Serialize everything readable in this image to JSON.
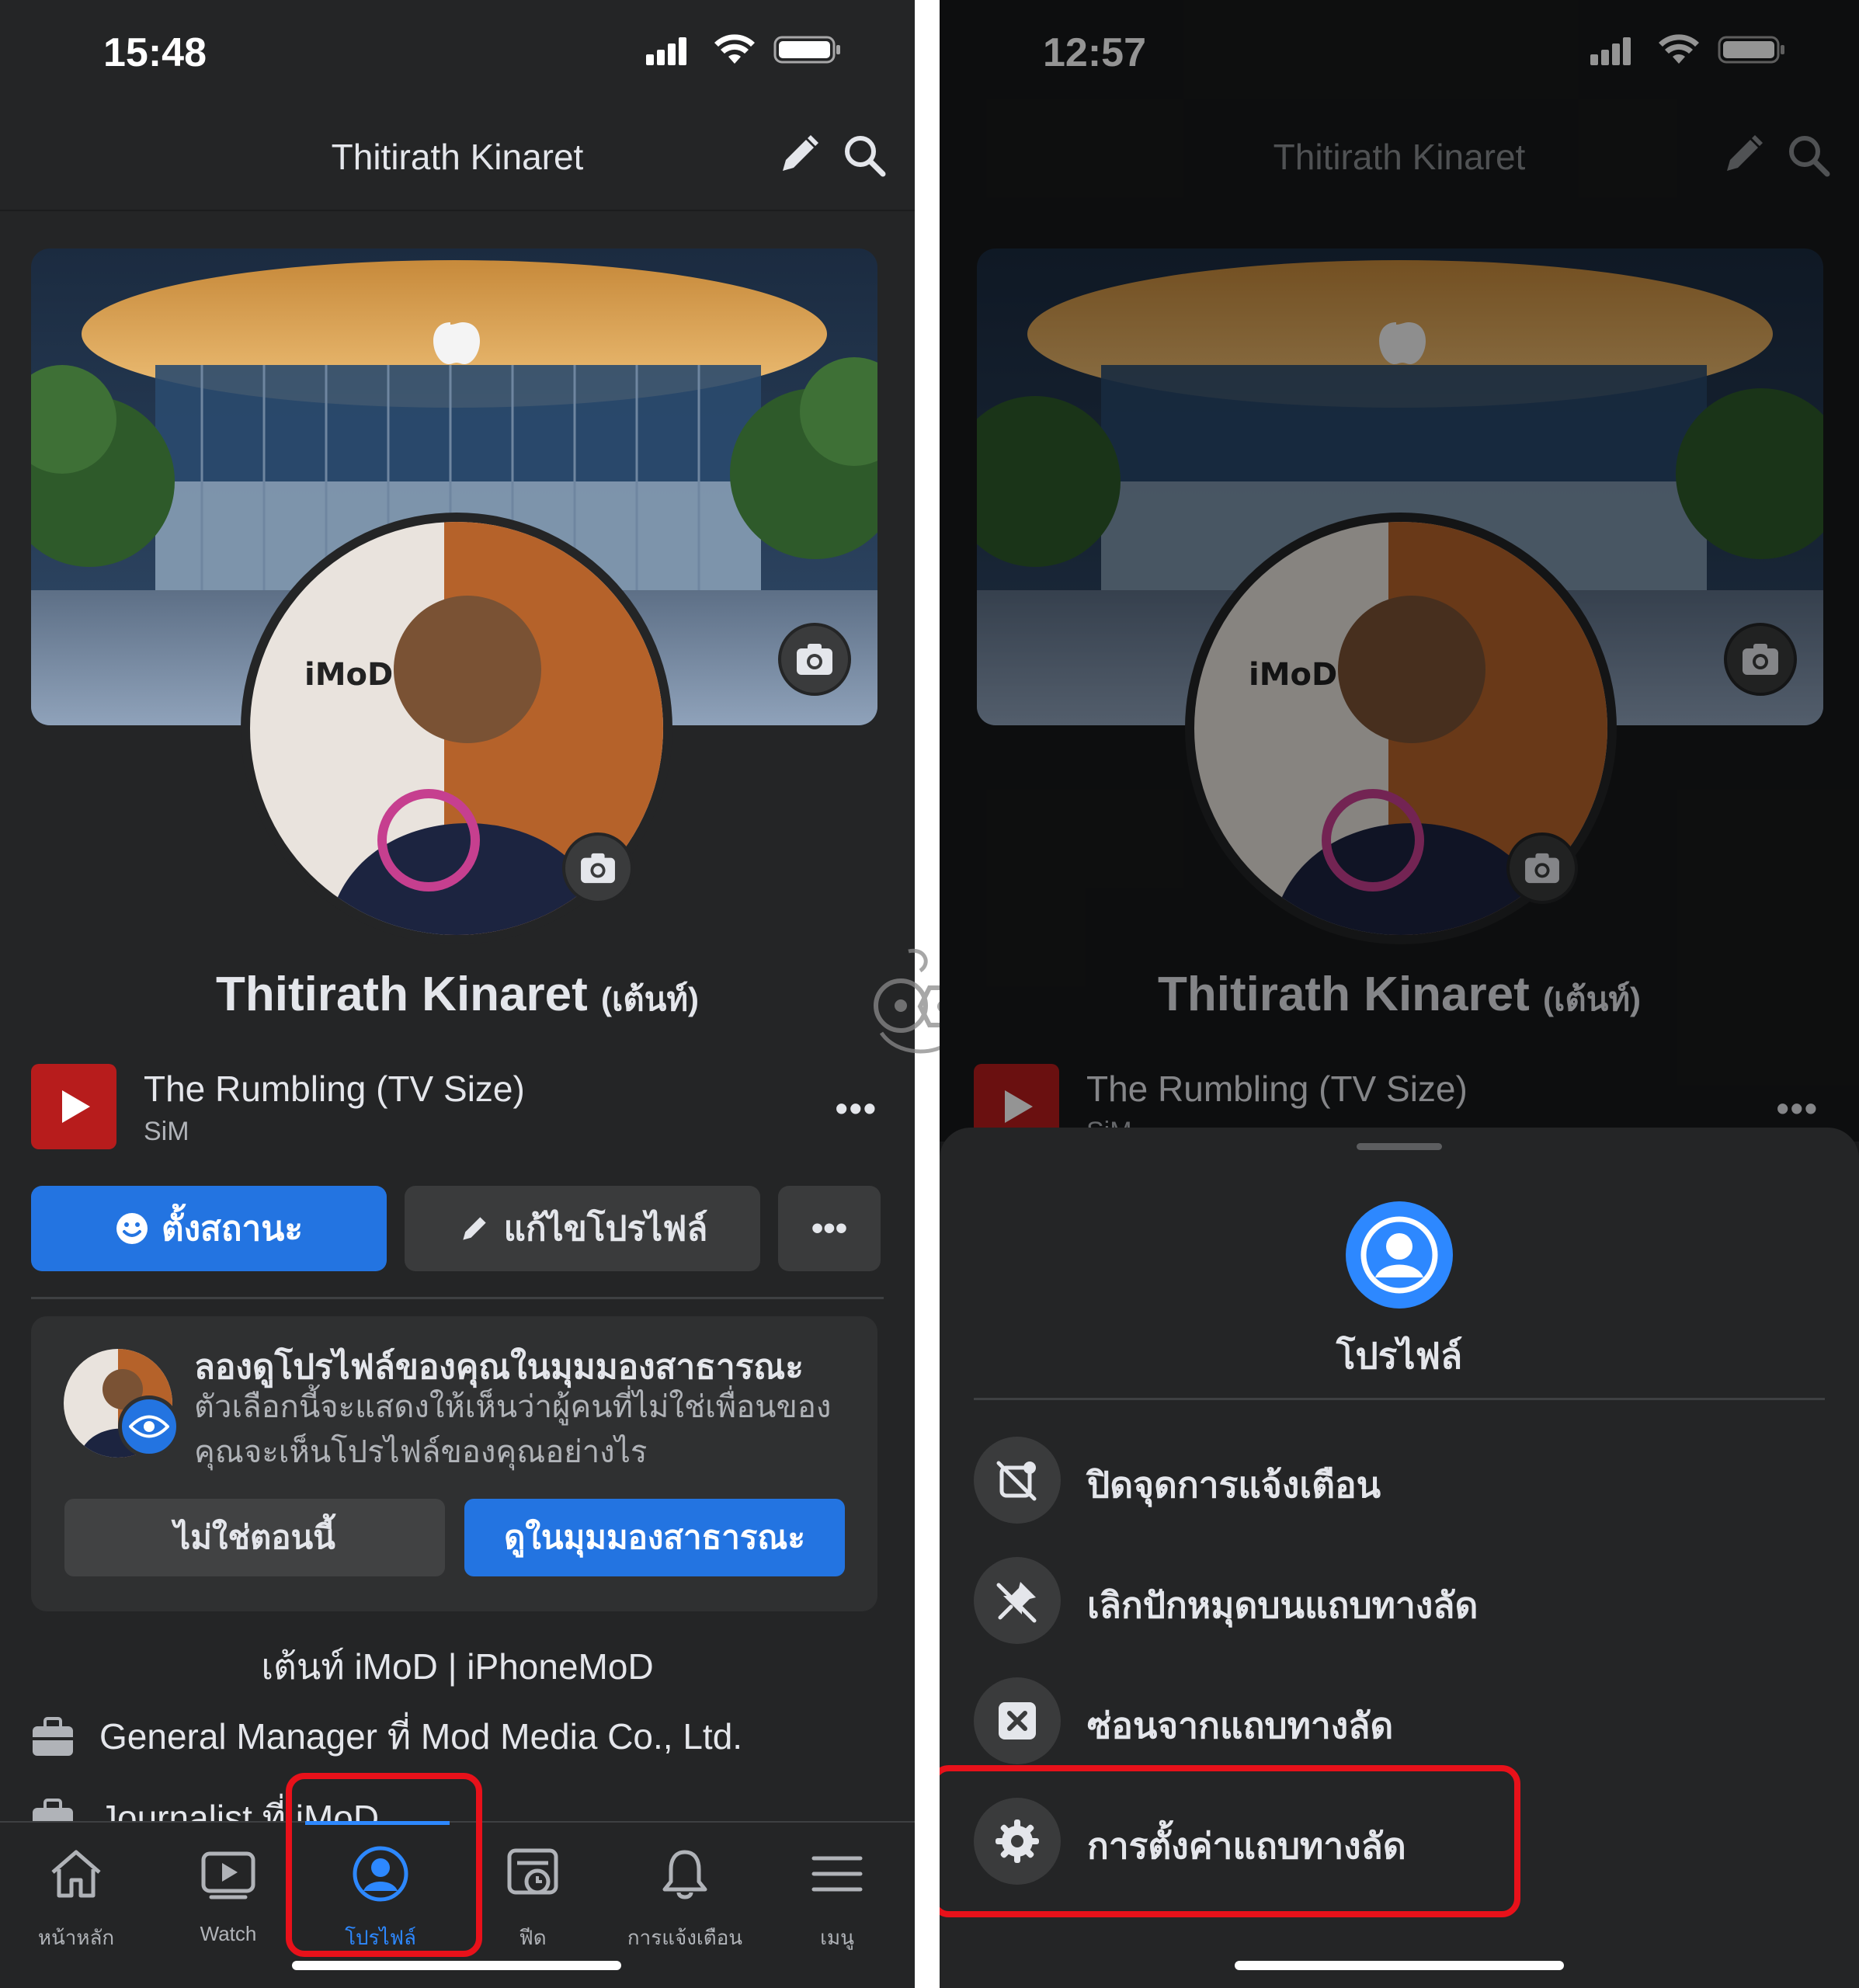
{
  "left": {
    "status": {
      "time": "15:48"
    },
    "nav": {
      "title": "Thitirath Kinaret"
    },
    "profile": {
      "name": "Thitirath Kinaret",
      "nickname": "(เต้นท์)"
    },
    "music": {
      "title": "The Rumbling (TV Size)",
      "artist": "SiM",
      "more": "•••"
    },
    "actions": {
      "status_label": "ตั้งสถานะ",
      "edit_label": "แก้ไขโปรไฟล์",
      "more": "•••"
    },
    "public_view_card": {
      "title": "ลองดูโปรไฟล์ของคุณในมุมมองสาธารณะ",
      "description": "ตัวเลือกนี้จะแสดงให้เห็นว่าผู้คนที่ไม่ใช่เพื่อนของคุณจะเห็นโปรไฟล์ของคุณอย่างไร",
      "not_now": "ไม่ใช่ตอนนี้",
      "view_public": "ดูในมุมมองสาธารณะ"
    },
    "bio": "เต้นท์ iMoD | iPhoneMoD",
    "work": [
      {
        "text": "General Manager ที่ Mod Media Co., Ltd."
      },
      {
        "text": "Journalist ที่ iMoD"
      }
    ],
    "tabs": [
      {
        "label": "หน้าหลัก",
        "icon": "home-icon"
      },
      {
        "label": "Watch",
        "icon": "watch-icon"
      },
      {
        "label": "โปรไฟล์",
        "icon": "profile-icon"
      },
      {
        "label": "ฟีด",
        "icon": "feed-icon"
      },
      {
        "label": "การแจ้งเตือน",
        "icon": "bell-icon"
      },
      {
        "label": "เมนู",
        "icon": "menu-icon"
      }
    ]
  },
  "right": {
    "status": {
      "time": "12:57"
    },
    "nav": {
      "title": "Thitirath Kinaret"
    },
    "profile": {
      "name": "Thitirath Kinaret",
      "nickname": "(เต้นท์)"
    },
    "music": {
      "title": "The Rumbling (TV Size)",
      "artist": "SiM",
      "more": "•••"
    },
    "sheet": {
      "title": "โปรไฟล์",
      "items": [
        {
          "label": "ปิดจุดการแจ้งเตือน",
          "icon": "notification-dot-off-icon"
        },
        {
          "label": "เลิกปักหมุดบนแถบทางลัด",
          "icon": "unpin-icon"
        },
        {
          "label": "ซ่อนจากแถบทางลัด",
          "icon": "hide-x-icon"
        },
        {
          "label": "การตั้งค่าแถบทางลัด",
          "icon": "gear-icon"
        }
      ]
    }
  },
  "colors": {
    "accent": "#2374e1",
    "highlight": "#e8111a",
    "background": "#242526"
  }
}
